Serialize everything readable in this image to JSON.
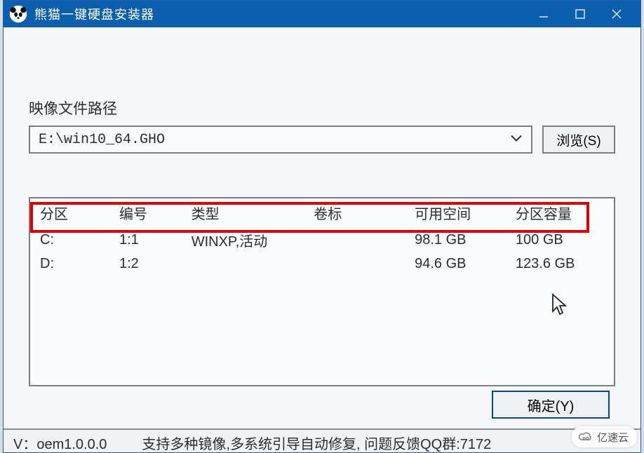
{
  "titlebar": {
    "title": "熊猫一键硬盘安装器"
  },
  "path_section": {
    "label": "映像文件路径",
    "value": "E:\\win10_64.GHO",
    "browse_label": "浏览(S)"
  },
  "table": {
    "headers": {
      "partition": "分区",
      "number": "编号",
      "type": "类型",
      "volume": "卷标",
      "free": "可用空间",
      "total": "分区容量"
    },
    "rows": [
      {
        "partition": "C:",
        "number": "1:1",
        "type": "WINXP,活动",
        "volume": "",
        "free": "98.1 GB",
        "total": "100 GB"
      },
      {
        "partition": "D:",
        "number": "1:2",
        "type": "",
        "volume": "",
        "free": "94.6 GB",
        "total": "123.6 GB"
      }
    ]
  },
  "buttons": {
    "ok": "确定(Y)"
  },
  "footer": {
    "version": "V：oem1.0.0.0",
    "info": "支持多种镜像,多系统引导自动修复, 问题反馈QQ群:7172"
  },
  "watermark": {
    "text": "亿速云"
  }
}
